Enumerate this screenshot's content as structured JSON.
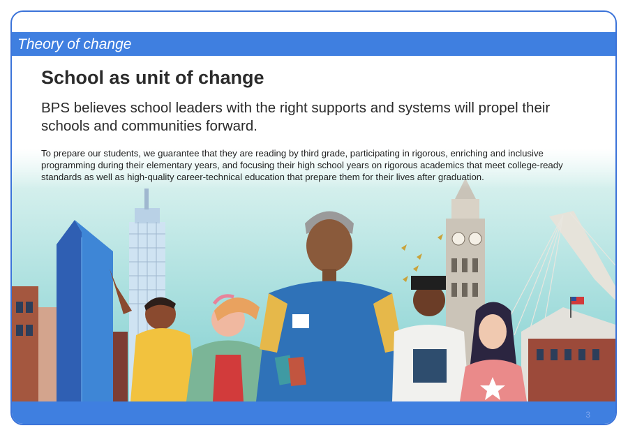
{
  "slide": {
    "section_label": "Theory of change",
    "title": "School as unit of change",
    "subtitle": "BPS believes school leaders with the right supports and systems will propel their schools and communities forward.",
    "body": "To prepare our students, we guarantee that they are reading by third grade, participating in rigorous, enriching and inclusive programming during their elementary years, and focusing their high school years on rigorous academics that meet college-ready standards as well as high-quality career-technical education that prepare them for their lives after graduation.",
    "page_number": "3"
  },
  "colors": {
    "accent_blue": "#3f7fe0",
    "border_blue": "#3b73d9",
    "sky_teal": "#8fd6d4",
    "text_dark": "#2b2b2b"
  },
  "illustration": {
    "subject": "illustrated city skyline with five students",
    "icons": [
      "skyscraper-icon",
      "clock-tower-icon",
      "bridge-icon",
      "flag-icon",
      "birds-icon"
    ]
  }
}
